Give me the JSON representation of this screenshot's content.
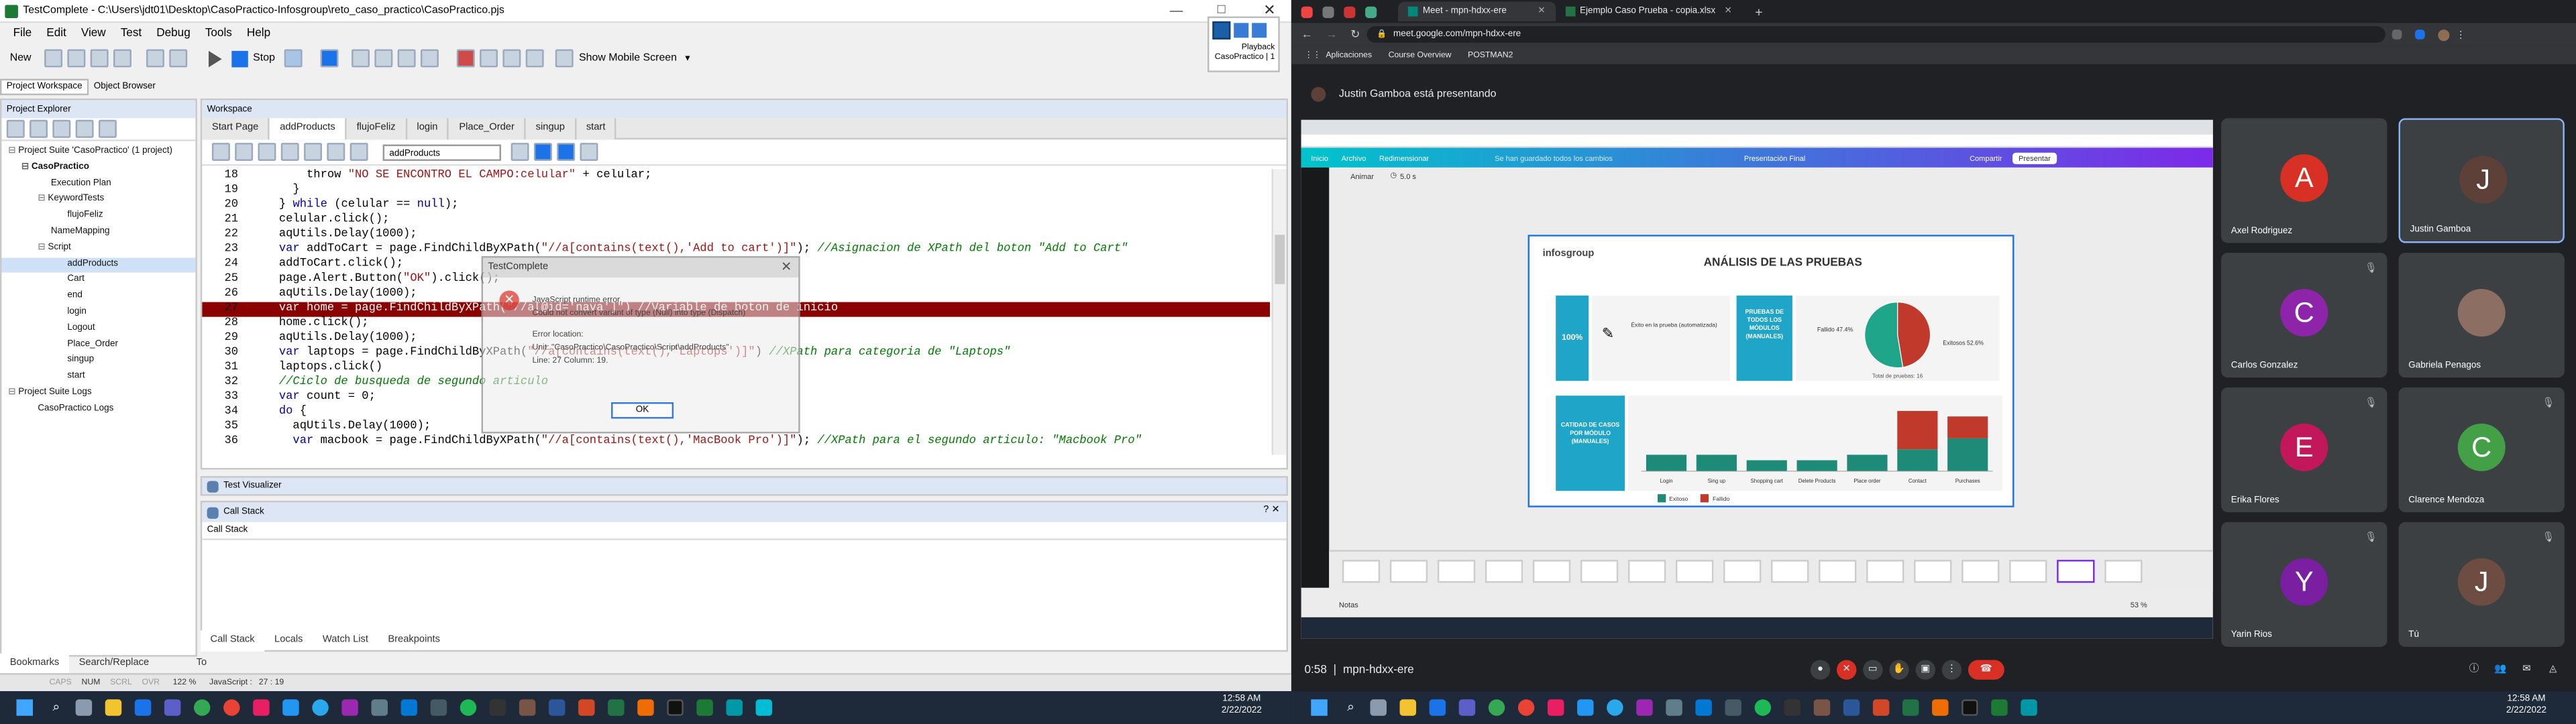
{
  "tc": {
    "title": "TestComplete - C:\\Users\\jdt01\\Desktop\\CasoPractico-Infosgroup\\reto_caso_practico\\CasoPractico.pjs",
    "menu": [
      "File",
      "Edit",
      "View",
      "Test",
      "Debug",
      "Tools",
      "Help"
    ],
    "toolbar": {
      "new": "New",
      "stop": "Stop",
      "mobile": "Show Mobile Screen"
    },
    "playback": {
      "label": "Playback",
      "project": "CasoPractico | 1"
    },
    "workspace_tabs": [
      "Project Workspace",
      "Object Browser"
    ],
    "explorer_title": "Project Explorer",
    "tree": [
      "Project Suite 'CasoPractico' (1 project)",
      "CasoPractico",
      "Execution Plan",
      "KeywordTests",
      "flujoFeliz",
      "NameMapping",
      "Script",
      "addProducts",
      "Cart",
      "end",
      "login",
      "Logout",
      "Place_Order",
      "singup",
      "start",
      "Project Suite Logs",
      "CasoPractico Logs"
    ],
    "workspace_title": "Workspace",
    "editor_tabs": [
      "Start Page",
      "addProducts",
      "flujoFeliz",
      "login",
      "Place_Order",
      "singup",
      "start"
    ],
    "routine": "addProducts",
    "code_lines": [
      {
        "n": "18",
        "segs": [
          [
            "p",
            "        throw "
          ],
          [
            "s",
            "\"NO SE ENCONTRO EL CAMPO:celular\""
          ],
          [
            "p",
            " + celular;"
          ]
        ]
      },
      {
        "n": "19",
        "segs": [
          [
            "p",
            "      }"
          ]
        ]
      },
      {
        "n": "20",
        "segs": [
          [
            "p",
            "    } "
          ],
          [
            "k",
            "while"
          ],
          [
            "p",
            " (celular == "
          ],
          [
            "k",
            "null"
          ],
          [
            "p",
            ");"
          ]
        ]
      },
      {
        "n": "21",
        "segs": [
          [
            "p",
            "    celular.click();"
          ]
        ]
      },
      {
        "n": "22",
        "segs": [
          [
            "p",
            "    aqUtils.Delay(1000);"
          ]
        ]
      },
      {
        "n": "23",
        "segs": [
          [
            "k",
            "    var"
          ],
          [
            "p",
            " addToCart = page.FindChildByXPath("
          ],
          [
            "s",
            "\"//a[contains(text(),'Add to cart')]\""
          ],
          [
            "p",
            "); "
          ],
          [
            "c",
            "//Asignacion de XPath del boton \"Add to Cart\""
          ]
        ]
      },
      {
        "n": "24",
        "segs": [
          [
            "p",
            "    addToCart.click();"
          ]
        ]
      },
      {
        "n": "25",
        "segs": [
          [
            "p",
            "    page.Alert.Button("
          ],
          [
            "s",
            "\"OK\""
          ],
          [
            "p",
            ").click();"
          ]
        ]
      },
      {
        "n": "26",
        "segs": [
          [
            "p",
            "    aqUtils.Delay(1000);"
          ]
        ]
      },
      {
        "n": "27",
        "hl": true,
        "segs": [
          [
            "p",
            "    var home = page.FindChildByXPath(\"//a[@id='nava']\") //Variable de boton de inicio"
          ]
        ]
      },
      {
        "n": "28",
        "segs": [
          [
            "p",
            "    home.click();"
          ]
        ]
      },
      {
        "n": "29",
        "segs": [
          [
            "p",
            "    aqUtils.Delay(1000);"
          ]
        ]
      },
      {
        "n": "30",
        "segs": [
          [
            "k",
            "    var"
          ],
          [
            "p",
            " laptops = page.FindChildByXPath("
          ],
          [
            "s",
            "\"//a[contains(text(),'Laptops')]\""
          ],
          [
            "p",
            ") "
          ],
          [
            "c",
            "//XPath para categoria de \"Laptops\""
          ]
        ]
      },
      {
        "n": "31",
        "segs": [
          [
            "p",
            "    laptops.click()"
          ]
        ]
      },
      {
        "n": "32",
        "segs": [
          [
            "c",
            "    //Ciclo de busqueda de segundo articulo"
          ]
        ]
      },
      {
        "n": "33",
        "segs": [
          [
            "k",
            "    var"
          ],
          [
            "p",
            " count = 0;"
          ]
        ]
      },
      {
        "n": "34",
        "segs": [
          [
            "k",
            "    do"
          ],
          [
            "p",
            " {"
          ]
        ]
      },
      {
        "n": "35",
        "segs": [
          [
            "p",
            "      aqUtils.Delay(1000);"
          ]
        ]
      },
      {
        "n": "36",
        "segs": [
          [
            "k",
            "      var"
          ],
          [
            "p",
            " macbook = page.FindChildByXPath("
          ],
          [
            "s",
            "\"//a[contains(text(),'MacBook Pro')]\""
          ],
          [
            "p",
            "); "
          ],
          [
            "c",
            "//XPath para el segundo articulo: \"Macbook Pro\""
          ]
        ]
      }
    ],
    "dialog": {
      "title": "TestComplete",
      "l1": "JavaScript runtime error.",
      "l2": "Could not convert variant of type (Null) into type (Dispatch)",
      "l3": "Error location:",
      "l4": "Unit: \"CasoPractico\\CasoPractico\\Script\\addProducts\"",
      "l5": "Line: 27 Column: 19.",
      "ok": "OK"
    },
    "test_visualizer": "Test Visualizer",
    "call_stack": "Call Stack",
    "call_stack_col": "Call Stack",
    "bottom_tabs": [
      "Call Stack",
      "Locals",
      "Watch List",
      "Breakpoints"
    ],
    "left_bottom_tabs": [
      "Bookmarks",
      "Search/Replace Results",
      "To Do"
    ],
    "status": [
      "CAPS",
      "NUM",
      "SCRL",
      "OVR",
      "122 %",
      "JavaScript :",
      "27 : 19"
    ]
  },
  "browser": {
    "tabs": [
      "Meet - mpn-hdxx-ere",
      "Ejemplo Caso Prueba - copia.xlsx"
    ],
    "url": "meet.google.com/mpn-hdxx-ere",
    "bookmarks": [
      "Aplicaciones",
      "Course Overview",
      "POSTMAN2"
    ],
    "presenting": "Justin Gamboa está presentando",
    "time": "0:58",
    "meeting": "mpn-hdxx-ere",
    "participants": [
      {
        "name": "Axel Rodriguez",
        "initial": "A",
        "color": "#d93025"
      },
      {
        "name": "Justin Gamboa",
        "initial": "J",
        "color": "#5d4037"
      },
      {
        "name": "Carlos Gonzalez",
        "initial": "C",
        "color": "#8e24aa"
      },
      {
        "name": "Gabriela Penagos",
        "initial": "",
        "color": "#8d6e63"
      },
      {
        "name": "Erika Flores",
        "initial": "E",
        "color": "#c2185b"
      },
      {
        "name": "Clarence Mendoza",
        "initial": "C",
        "color": "#43a047"
      },
      {
        "name": "Yarin Rios",
        "initial": "Y",
        "color": "#7b1fa2"
      },
      {
        "name": "Tú",
        "initial": "J",
        "color": "#6d4c41"
      }
    ]
  },
  "slide": {
    "doc_title": "Presentación Final",
    "menu": [
      "Inicio",
      "Archivo",
      "Redimensionar"
    ],
    "unsaved": "Se han guardado todos los cambios",
    "share": "Compartir",
    "present": "Presentar",
    "animate": "Animar",
    "duration": "5.0 s",
    "logo": "infosgroup",
    "heading": "ANÁLISIS DE LAS PRUEBAS",
    "kpi_pct": "100%",
    "kpi_text": "Éxito en la prueba (automatizada)",
    "side_label": "PRUEBAS DE TODOS LOS MÓDULOS (MANUALES)",
    "bar_label": "CATIDAD DE CASOS POR MÓDULO (MANUALES)",
    "notes": "Notas",
    "zoom": "53 %",
    "pie_caption": "Total de pruebas: 16"
  },
  "chart_data": [
    {
      "type": "pie",
      "categories": [
        "Fallido",
        "Exitosos"
      ],
      "values": [
        47.4,
        52.6
      ],
      "labels": [
        "Fallido 47.4%",
        "Exitosos 52.6%"
      ],
      "colors": [
        "#c0392b",
        "#1ea58a"
      ]
    },
    {
      "type": "bar",
      "categories": [
        "Login",
        "Sing up",
        "Shopping cart",
        "Delete Products",
        "Place order",
        "Contact",
        "Purchases"
      ],
      "series": [
        {
          "name": "Exitoso",
          "values": [
            3,
            3,
            2,
            2,
            3,
            4,
            6
          ],
          "color": "#1e8a78"
        },
        {
          "name": "Fallido",
          "values": [
            0,
            0,
            0,
            0,
            0,
            7,
            4
          ],
          "color": "#c0392b"
        }
      ],
      "ylim": [
        0,
        12
      ]
    }
  ],
  "taskbar": {
    "left_time": "12:58 AM",
    "left_date": "2/22/2022",
    "right_time": "12:58 AM",
    "right_date": "2/22/2022"
  },
  "colors": {
    "code_highlight": "#8b0000",
    "meet_bg": "#202124",
    "accent": "#1a73e8",
    "tc_titlebar": "#ffffff"
  }
}
